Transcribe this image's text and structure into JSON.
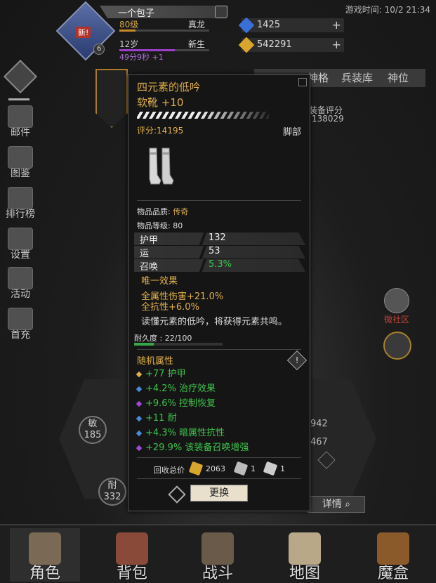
{
  "clock": "游戏时间: 10/2 21:34",
  "profile": {
    "badge": "新!",
    "badge_level": "6",
    "name": "一个包子",
    "level": "80级",
    "rank": "真龙",
    "level_progress": 0.18,
    "age": "12岁",
    "stage": "新生",
    "age_progress": 0.62,
    "timer": "49分9秒 +1"
  },
  "currencies": [
    {
      "icon": "blue-gem-icon",
      "value": "1425",
      "color": "#3a6fd8"
    },
    {
      "icon": "gold-gem-icon",
      "value": "542291",
      "color": "#d8a62a"
    }
  ],
  "side_menu": [
    {
      "icon": "mail-icon",
      "label": "邮件"
    },
    {
      "icon": "book-icon",
      "label": "图鉴"
    },
    {
      "icon": "leaderboard-icon",
      "label": "排行榜"
    },
    {
      "icon": "gear-icon",
      "label": "设置"
    },
    {
      "icon": "event-icon",
      "label": "活动"
    },
    {
      "icon": "recharge-icon",
      "label": "首充"
    }
  ],
  "bg_tabs": [
    "神格",
    "兵装库",
    "神位"
  ],
  "bg_equip_score": {
    "label": "装备评分",
    "value": "138029"
  },
  "bg_stats": {
    "agility": {
      "label": "敏",
      "value": "185"
    },
    "endurance": {
      "label": "耐",
      "value": "332"
    },
    "num1": "942",
    "num2": "467"
  },
  "community": "微社区",
  "detail_button": "详情",
  "tooltip": {
    "title": "四元素的低吟",
    "subtitle": "软靴 +10",
    "score": "评分:14195",
    "slot": "脚部",
    "quality_label": "物品品质: ",
    "quality_value": "传奇",
    "level_label": "物品等级: 80",
    "base_stats": [
      {
        "label": "护甲",
        "value": "132",
        "color": "#eeeeee"
      },
      {
        "label": "运",
        "value": "53",
        "color": "#eeeeee"
      },
      {
        "label": "召唤",
        "value": "5.3%",
        "color": "#3dc44b"
      }
    ],
    "unique_header": "唯一效果",
    "unique_lines": [
      "全属性伤害+21.0%",
      "全抗性+6.0%"
    ],
    "lore": "读懂元素的低吟，将获得元素共鸣。",
    "durability_label": "耐久度 : 22/100",
    "durability": 0.22,
    "random_header": "随机属性",
    "warn_icon": "!",
    "affixes": [
      {
        "text": "+77 护甲",
        "gem_color": "#e0b04a"
      },
      {
        "text": "+4.2% 治疗效果",
        "gem_color": "#4a8ad8"
      },
      {
        "text": "+9.6% 控制恢复",
        "gem_color": "#a04ad8"
      },
      {
        "text": "+11 耐",
        "gem_color": "#4a8ad8"
      },
      {
        "text": "+4.3% 暗属性抗性",
        "gem_color": "#4a8ad8"
      },
      {
        "text": "+29.9% 该装备召唤增强",
        "gem_color": "#a04ad8"
      }
    ],
    "recycle_label": "回收总价",
    "recycle": [
      {
        "icon": "gold-ore-icon",
        "value": "2063",
        "color": "#d8a62a"
      },
      {
        "icon": "stone-icon",
        "value": "1",
        "color": "#bbbbbb"
      },
      {
        "icon": "crystal-icon",
        "value": "1",
        "color": "#cccccc"
      }
    ],
    "replace_button": "更换"
  },
  "bottom_nav": [
    {
      "icon": "helmet-icon",
      "label": "角色",
      "selected": true
    },
    {
      "icon": "backpack-icon",
      "label": "背包",
      "selected": false
    },
    {
      "icon": "sword-shield-icon",
      "label": "战斗",
      "selected": false
    },
    {
      "icon": "map-scroll-icon",
      "label": "地图",
      "selected": false
    },
    {
      "icon": "magic-box-icon",
      "label": "魔盒",
      "selected": false
    }
  ]
}
